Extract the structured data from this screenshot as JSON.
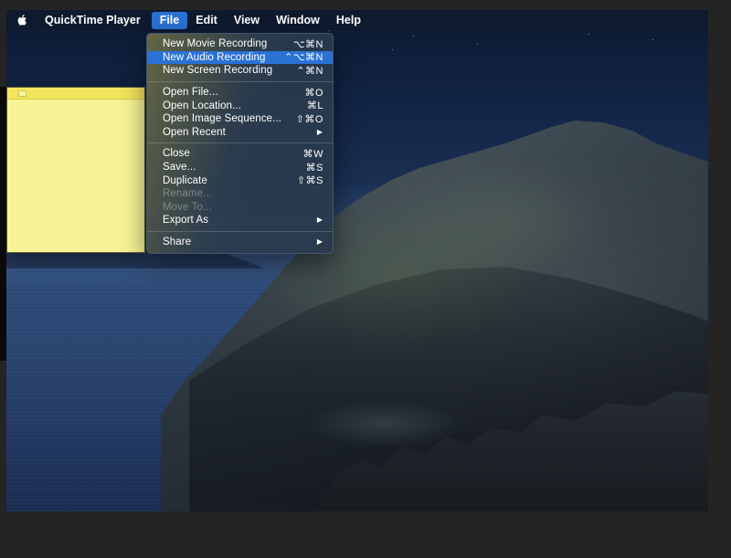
{
  "menubar": {
    "apple_icon": "apple-logo",
    "app_title": "QuickTime Player",
    "items": [
      {
        "label": "File",
        "active": true
      },
      {
        "label": "Edit",
        "active": false
      },
      {
        "label": "View",
        "active": false
      },
      {
        "label": "Window",
        "active": false
      },
      {
        "label": "Help",
        "active": false
      }
    ]
  },
  "file_menu": {
    "groups": [
      {
        "items": [
          {
            "label": "New Movie Recording",
            "shortcut": "⌥⌘N",
            "highlighted": false,
            "disabled": false,
            "submenu": false
          },
          {
            "label": "New Audio Recording",
            "shortcut": "⌃⌥⌘N",
            "highlighted": true,
            "disabled": false,
            "submenu": false
          },
          {
            "label": "New Screen Recording",
            "shortcut": "⌃⌘N",
            "highlighted": false,
            "disabled": false,
            "submenu": false
          }
        ]
      },
      {
        "items": [
          {
            "label": "Open File...",
            "shortcut": "⌘O",
            "highlighted": false,
            "disabled": false,
            "submenu": false
          },
          {
            "label": "Open Location...",
            "shortcut": "⌘L",
            "highlighted": false,
            "disabled": false,
            "submenu": false
          },
          {
            "label": "Open Image Sequence...",
            "shortcut": "⇧⌘O",
            "highlighted": false,
            "disabled": false,
            "submenu": false
          },
          {
            "label": "Open Recent",
            "shortcut": "",
            "highlighted": false,
            "disabled": false,
            "submenu": true
          }
        ]
      },
      {
        "items": [
          {
            "label": "Close",
            "shortcut": "⌘W",
            "highlighted": false,
            "disabled": false,
            "submenu": false
          },
          {
            "label": "Save...",
            "shortcut": "⌘S",
            "highlighted": false,
            "disabled": false,
            "submenu": false
          },
          {
            "label": "Duplicate",
            "shortcut": "⇧⌘S",
            "highlighted": false,
            "disabled": false,
            "submenu": false
          },
          {
            "label": "Rename...",
            "shortcut": "",
            "highlighted": false,
            "disabled": true,
            "submenu": false
          },
          {
            "label": "Move To...",
            "shortcut": "",
            "highlighted": false,
            "disabled": true,
            "submenu": false
          },
          {
            "label": "Export As",
            "shortcut": "",
            "highlighted": false,
            "disabled": false,
            "submenu": true
          }
        ]
      },
      {
        "items": [
          {
            "label": "Share",
            "shortcut": "",
            "highlighted": false,
            "disabled": false,
            "submenu": true
          }
        ]
      }
    ],
    "submenu_arrow": "▶"
  },
  "stickies_window": {
    "name": "sticky-note",
    "body_text": "",
    "background_color": "#f7f394",
    "titlebar_color": "#f2e35a"
  },
  "desktop": {
    "wallpaper_name": "catalina-night-coastline"
  },
  "colors": {
    "accent_highlight": "#2a72d4",
    "menubar_background": "#101a2d",
    "menu_background": "#2a3a4e",
    "frame": "#242424"
  }
}
